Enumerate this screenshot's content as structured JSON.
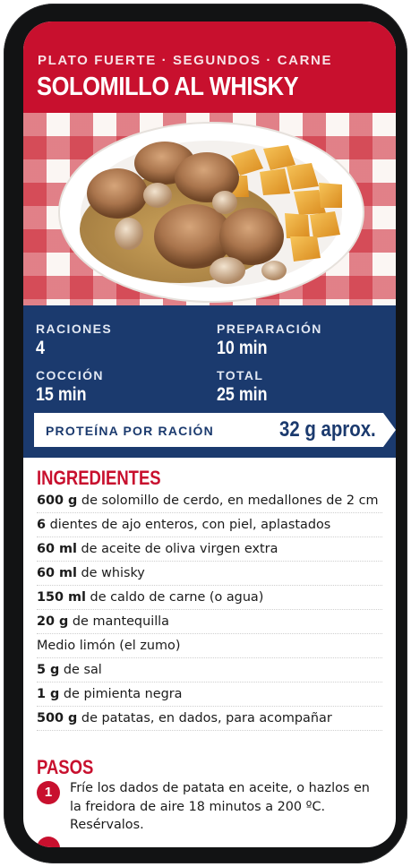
{
  "header": {
    "category": "PLATO FUERTE · SEGUNDOS · CARNE",
    "title": "SOLOMILLO AL WHISKY"
  },
  "stats": [
    {
      "label": "RACIONES",
      "value": "4"
    },
    {
      "label": "PREPARACIÓN",
      "value": "10 min"
    },
    {
      "label": "COCCIÓN",
      "value": "15 min"
    },
    {
      "label": "TOTAL",
      "value": "25 min"
    }
  ],
  "protein": {
    "label": "PROTEÍNA POR RACIÓN",
    "value": "32 g aprox."
  },
  "ingredients": {
    "title": "INGREDIENTES",
    "items": [
      {
        "qty": "600 g",
        "text": " de solomillo de cerdo, en medallones de 2 cm"
      },
      {
        "qty": "6",
        "text": " dientes de ajo enteros, con piel, aplastados"
      },
      {
        "qty": "60 ml",
        "text": " de aceite de oliva virgen extra"
      },
      {
        "qty": "60 ml",
        "text": " de whisky"
      },
      {
        "qty": "150 ml",
        "text": " de caldo de carne (o agua)"
      },
      {
        "qty": "20 g",
        "text": " de mantequilla"
      },
      {
        "qty": "",
        "text": "Medio limón (el zumo)"
      },
      {
        "qty": "5 g",
        "text": " de sal"
      },
      {
        "qty": "1 g",
        "text": " de pimienta negra"
      },
      {
        "qty": "500 g",
        "text": " de patatas, en dados, para acompañar"
      }
    ]
  },
  "steps": {
    "title": "PASOS",
    "items": [
      {
        "number": "1",
        "text": "Fríe los dados de patata en aceite, o hazlos en la freidora de aire 18 minutos a 200 ºC. Resérvalos."
      }
    ]
  },
  "colors": {
    "brand_red": "#c8102e",
    "brand_navy": "#1b3a6e"
  }
}
